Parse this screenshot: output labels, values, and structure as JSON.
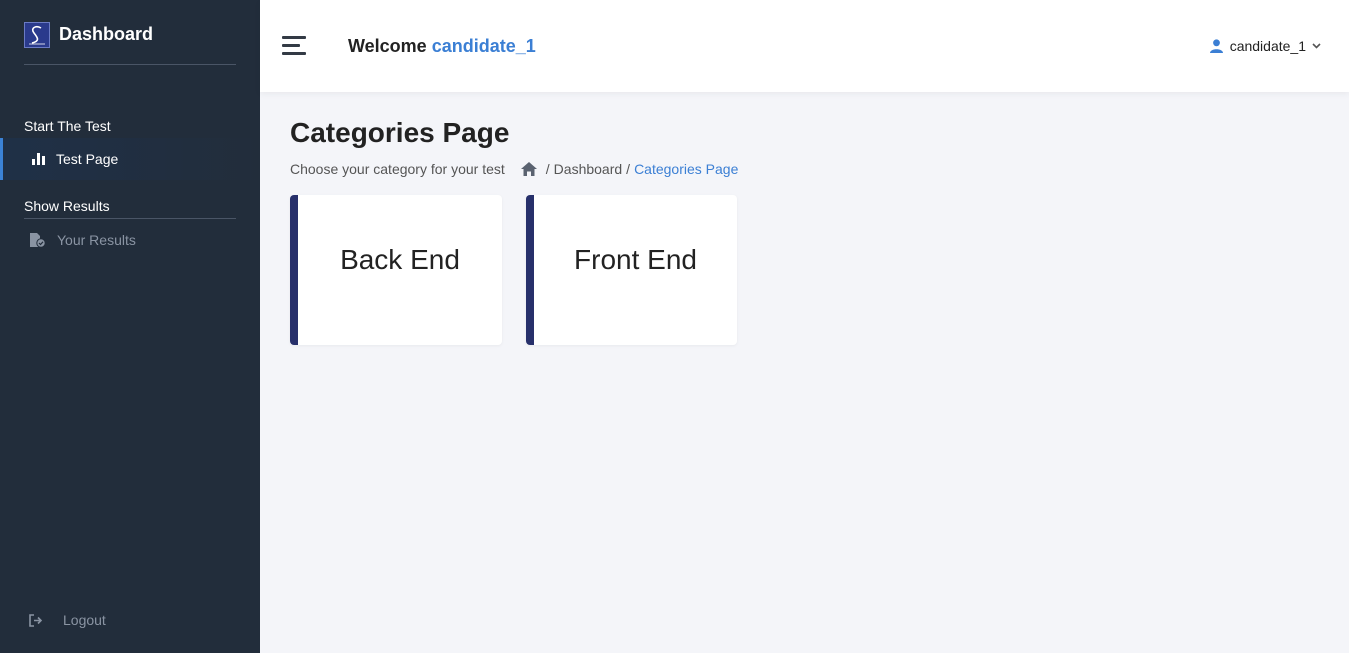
{
  "sidebar": {
    "brand_title": "Dashboard",
    "section_test": "Start The Test",
    "test_page_label": "Test Page",
    "section_results": "Show Results",
    "results_label": "Your Results",
    "logout_label": "Logout",
    "icons": {
      "logo": "brand-logo",
      "test_page": "bar-chart-icon",
      "results": "file-check-icon",
      "logout": "sign-out-icon"
    }
  },
  "header": {
    "welcome_prefix": "Welcome",
    "welcome_user": "candidate_1",
    "user_menu_label": "candidate_1",
    "icons": {
      "menu": "hamburger-icon",
      "user": "user-icon",
      "chevron": "chevron-down-icon"
    }
  },
  "main": {
    "page_title": "Categories Page",
    "subtitle": "Choose your category for your test",
    "breadcrumb": {
      "home_icon": "home-icon",
      "separator": "/",
      "dashboard": "Dashboard",
      "current": "Categories Page"
    },
    "categories": [
      {
        "label": "Back End"
      },
      {
        "label": "Front End"
      }
    ]
  },
  "colors": {
    "sidebar_bg": "#222d3b",
    "accent": "#3b7fd4",
    "card_border": "#27306b",
    "page_bg": "#f4f5f9"
  }
}
